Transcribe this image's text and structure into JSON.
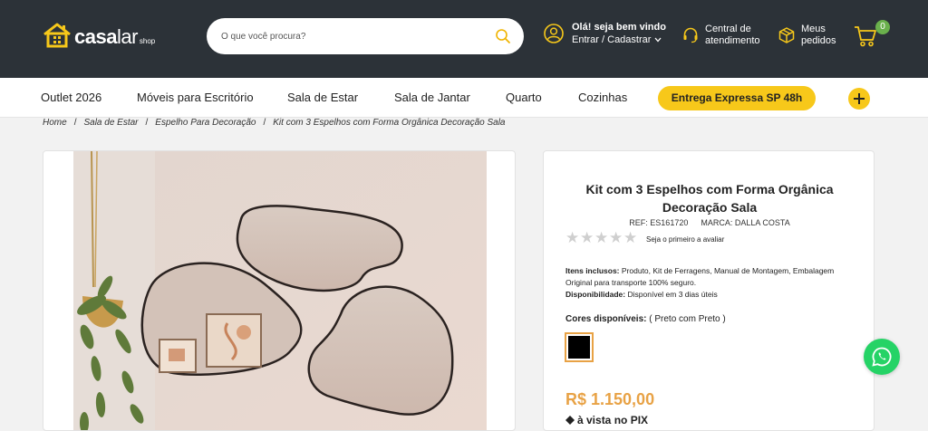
{
  "header": {
    "logo": {
      "casa": "casa",
      "lar": "lar",
      "shop": "shop"
    },
    "search": {
      "placeholder": "O que você procura?"
    },
    "account": {
      "greeting": "Olá! seja bem vindo",
      "login": "Entrar / Cadastrar"
    },
    "support": {
      "line1": "Central de",
      "line2": "atendimento"
    },
    "orders": {
      "line1": "Meus",
      "line2": "pedidos"
    },
    "cart": {
      "count": "0"
    },
    "accent_color": "#f7c81a",
    "bg_color": "#2c3238"
  },
  "nav": {
    "items": [
      "Outlet 2026",
      "Móveis para Escritório",
      "Sala de Estar",
      "Sala de Jantar",
      "Quarto",
      "Cozinhas"
    ],
    "express": "Entrega Expressa SP 48h"
  },
  "breadcrumb": [
    "Home",
    "Sala de Estar",
    "Espelho Para Decoração",
    "Kit com 3 Espelhos com Forma Orgânica Decoração Sala"
  ],
  "product": {
    "title_line1": "Kit com 3 Espelhos com Forma Orgânica",
    "title_line2": "Decoração Sala",
    "ref_label": "REF:",
    "ref": "ES161720",
    "brand_label": "MARCA:",
    "brand": "DALLA COSTA",
    "rating": 0,
    "rating_max": 5,
    "review_prompt": "Seja o primeiro a avaliar",
    "items_label": "Itens inclusos:",
    "items_text": "Produto, Kit de Ferragens, Manual de Montagem, Embalagem Original para transporte 100% seguro.",
    "availability_label": "Disponibilidade:",
    "availability_text": "Disponível em 3 dias úteis",
    "colors_label": "Cores disponíveis:",
    "colors_value": "( Preto com Preto )",
    "swatch_color": "#000000",
    "price": "R$ 1.150,00",
    "pix_text": "à vista no PIX",
    "price_color": "#e8a245"
  }
}
